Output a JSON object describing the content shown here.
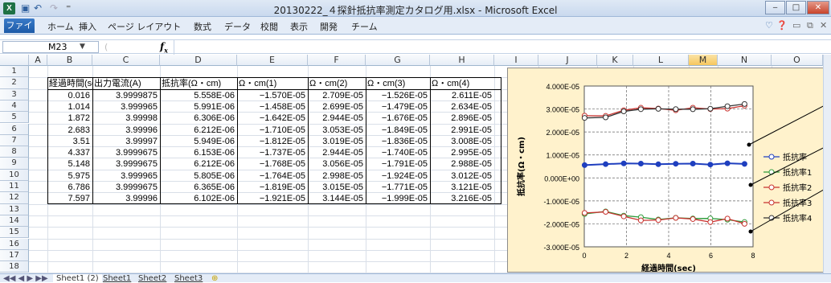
{
  "window": {
    "title": "20130222_４探針抵抗率測定カタログ用.xlsx - Microsoft Excel",
    "app_icon": "X",
    "minimize": "‒",
    "maximize": "□",
    "close": "✕"
  },
  "ribbon": {
    "file": "ファイル",
    "tabs": [
      "ホーム",
      "挿入",
      "ページ レイアウト",
      "数式",
      "データ",
      "校閲",
      "表示",
      "開発",
      "チーム"
    ]
  },
  "formula": {
    "namebox": "M23",
    "fx": "fx",
    "content": ""
  },
  "columns": [
    "A",
    "B",
    "C",
    "D",
    "E",
    "F",
    "G",
    "H",
    "I",
    "J",
    "K",
    "L",
    "M",
    "N",
    "O"
  ],
  "selected_column": "M",
  "rows": [
    "1",
    "2",
    "3",
    "4",
    "5",
    "6",
    "7",
    "8",
    "9",
    "10",
    "11",
    "12",
    "13",
    "14",
    "15",
    "16",
    "17",
    "18"
  ],
  "table": {
    "headers": [
      "経過時間(sec)",
      "出力電流(A)",
      "抵抗率(Ω・cm)",
      "Ω・cm(1)",
      "Ω・cm(2)",
      "Ω・cm(3)",
      "Ω・cm(4)"
    ],
    "rows": [
      [
        "0.016",
        "3.9999875",
        "5.558E-06",
        "−1.570E-05",
        "2.709E-05",
        "−1.526E-05",
        "2.611E-05"
      ],
      [
        "1.014",
        "3.999965",
        "5.991E-06",
        "−1.458E-05",
        "2.699E-05",
        "−1.479E-05",
        "2.634E-05"
      ],
      [
        "1.872",
        "3.99998",
        "6.306E-06",
        "−1.642E-05",
        "2.944E-05",
        "−1.676E-05",
        "2.896E-05"
      ],
      [
        "2.683",
        "3.99996",
        "6.212E-06",
        "−1.710E-05",
        "3.053E-05",
        "−1.849E-05",
        "2.991E-05"
      ],
      [
        "3.51",
        "3.99997",
        "5.949E-06",
        "−1.812E-05",
        "3.019E-05",
        "−1.836E-05",
        "3.008E-05"
      ],
      [
        "4.337",
        "3.9999675",
        "6.153E-06",
        "−1.737E-05",
        "2.944E-05",
        "−1.740E-05",
        "2.995E-05"
      ],
      [
        "5.148",
        "3.9999675",
        "6.212E-06",
        "−1.768E-05",
        "3.056E-05",
        "−1.791E-05",
        "2.988E-05"
      ],
      [
        "5.975",
        "3.999965",
        "5.805E-06",
        "−1.764E-05",
        "2.998E-05",
        "−1.924E-05",
        "3.012E-05"
      ],
      [
        "6.786",
        "3.9999675",
        "6.365E-06",
        "−1.819E-05",
        "3.015E-05",
        "−1.771E-05",
        "3.121E-05"
      ],
      [
        "7.597",
        "3.99996",
        "6.102E-06",
        "−1.921E-05",
        "3.144E-05",
        "−1.999E-05",
        "3.216E-05"
      ]
    ]
  },
  "chart_data": {
    "type": "line",
    "xlabel": "経過時間(sec)",
    "ylabel": "抵抗率(Ω・cm)",
    "xlim": [
      0,
      8
    ],
    "ylim": [
      -3e-05,
      4e-05
    ],
    "xticks": [
      "0",
      "2",
      "4",
      "6",
      "8"
    ],
    "yticks": [
      "4.000E-05",
      "3.000E-05",
      "2.000E-05",
      "1.000E-05",
      "0.000E+00",
      "-1.000E-05",
      "-2.000E-05",
      "-3.000E-05"
    ],
    "x": [
      0.016,
      1.014,
      1.872,
      2.683,
      3.51,
      4.337,
      5.148,
      5.975,
      6.786,
      7.597
    ],
    "series": [
      {
        "name": "抵抗率",
        "color": "#1f3fbf",
        "values": [
          5.558e-06,
          5.991e-06,
          6.306e-06,
          6.212e-06,
          5.949e-06,
          6.153e-06,
          6.212e-06,
          5.805e-06,
          6.365e-06,
          6.102e-06
        ]
      },
      {
        "name": "抵抗率1",
        "color": "#2e9b3a",
        "values": [
          -1.57e-05,
          -1.458e-05,
          -1.642e-05,
          -1.71e-05,
          -1.812e-05,
          -1.737e-05,
          -1.768e-05,
          -1.764e-05,
          -1.819e-05,
          -1.921e-05
        ]
      },
      {
        "name": "抵抗率2",
        "color": "#c8322e",
        "values": [
          2.709e-05,
          2.699e-05,
          2.944e-05,
          3.053e-05,
          3.019e-05,
          2.944e-05,
          3.056e-05,
          2.998e-05,
          3.015e-05,
          3.144e-05
        ]
      },
      {
        "name": "抵抗率3",
        "color": "#c8322e",
        "values": [
          -1.526e-05,
          -1.479e-05,
          -1.676e-05,
          -1.849e-05,
          -1.836e-05,
          -1.74e-05,
          -1.791e-05,
          -1.924e-05,
          -1.771e-05,
          -1.999e-05
        ]
      },
      {
        "name": "抵抗率4",
        "color": "#333333",
        "values": [
          2.611e-05,
          2.634e-05,
          2.896e-05,
          2.991e-05,
          3.008e-05,
          2.995e-05,
          2.988e-05,
          3.012e-05,
          3.121e-05,
          3.216e-05
        ]
      }
    ],
    "legend": "right",
    "grid": "dashed"
  },
  "sheets": [
    "Sheet1 (2)",
    "Sheet1",
    "Sheet2",
    "Sheet3"
  ],
  "nav": "◀◀ ◀ ▶ ▶▶"
}
